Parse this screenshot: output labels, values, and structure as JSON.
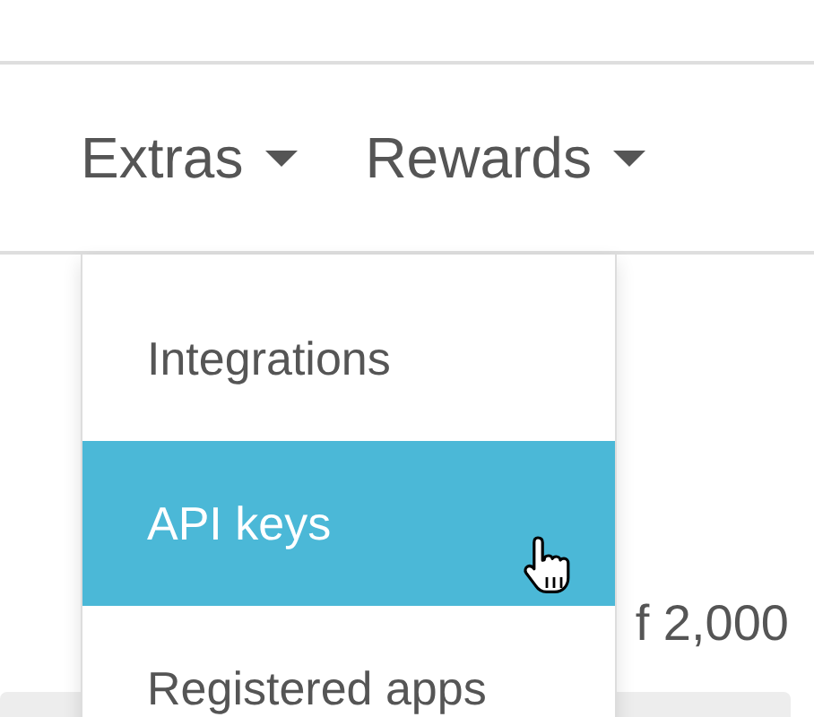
{
  "nav": [
    {
      "label": "Extras"
    },
    {
      "label": "Rewards"
    }
  ],
  "dropdown": {
    "items": [
      {
        "label": "Integrations",
        "selected": false
      },
      {
        "label": "API keys",
        "selected": true
      },
      {
        "label": "Registered apps",
        "selected": false
      }
    ]
  },
  "background_text": "f 2,000"
}
